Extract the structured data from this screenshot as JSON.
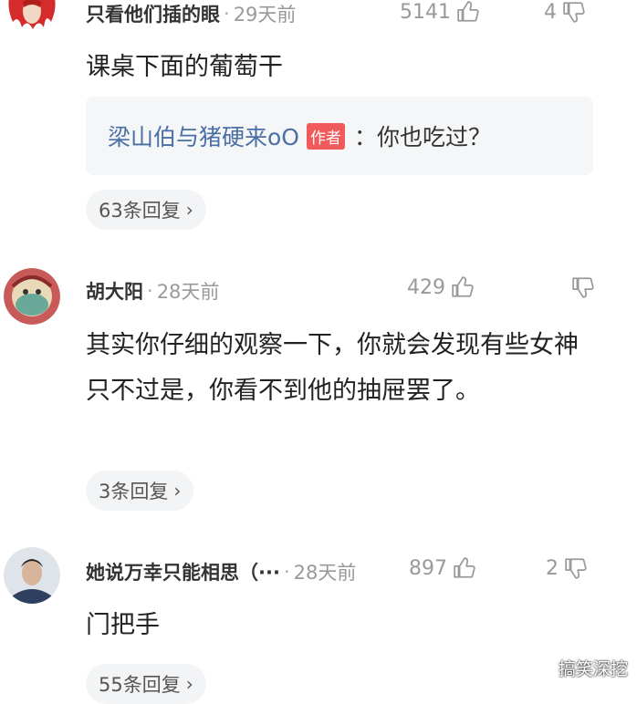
{
  "comments": [
    {
      "name": "只看他们插的眼",
      "time": "29天前",
      "likes": "5141",
      "dislikes": "4",
      "content": "课桌下面的葡萄干",
      "reply": {
        "name": "梁山伯与猪硬来oO",
        "badge": "作者",
        "text": "：你也吃过？"
      },
      "replies": "63条回复",
      "avatar_color": "#d62b2b"
    },
    {
      "name": "胡大阳",
      "time": "28天前",
      "likes": "429",
      "dislikes": "",
      "content": "其实你仔细的观察一下，你就会发现有些女神只不过是，你看不到他的抽屉罢了。",
      "replies": "3条回复",
      "avatar_color": "#b84a4a"
    },
    {
      "name": "她说万幸只能相思（···",
      "time": "28天前",
      "likes": "897",
      "dislikes": "2",
      "content": "门把手",
      "replies": "55条回复",
      "avatar_color": "#3a4a6a"
    }
  ],
  "separator_dot": "·",
  "chevron": "›",
  "watermark": "搞笑深挖",
  "colors": {
    "reply_name": "#4a6fa5",
    "badge_bg": "#f05a5a",
    "meta": "#999999"
  }
}
